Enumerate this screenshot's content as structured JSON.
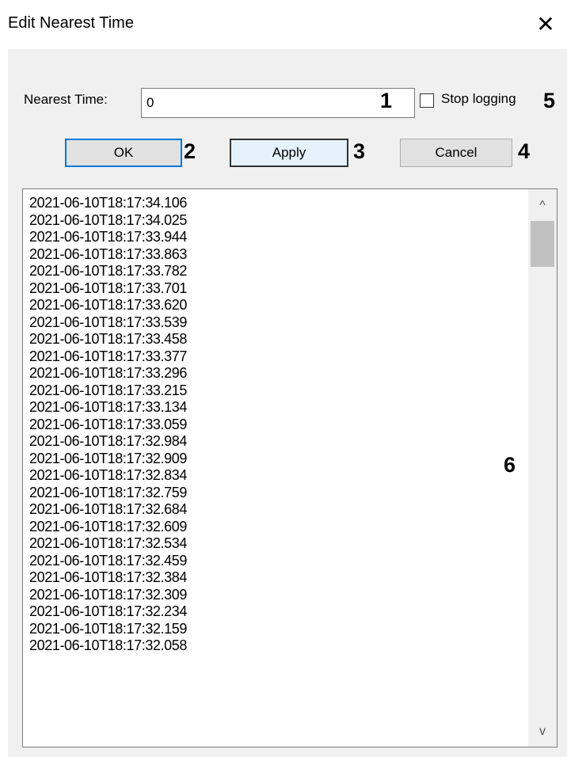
{
  "window": {
    "title": "Edit Nearest Time",
    "close_glyph": "✕"
  },
  "form": {
    "nearest_time_label": "Nearest Time:",
    "nearest_time_value": "0",
    "stop_logging_label": "Stop logging",
    "stop_logging_checked": false
  },
  "buttons": {
    "ok": "OK",
    "apply": "Apply",
    "cancel": "Cancel"
  },
  "annotations": {
    "n1": "1",
    "n2": "2",
    "n3": "3",
    "n4": "4",
    "n5": "5",
    "n6": "6"
  },
  "log": {
    "items": [
      "2021-06-10T18:17:34.106",
      "2021-06-10T18:17:34.025",
      "2021-06-10T18:17:33.944",
      "2021-06-10T18:17:33.863",
      "2021-06-10T18:17:33.782",
      "2021-06-10T18:17:33.701",
      "2021-06-10T18:17:33.620",
      "2021-06-10T18:17:33.539",
      "2021-06-10T18:17:33.458",
      "2021-06-10T18:17:33.377",
      "2021-06-10T18:17:33.296",
      "2021-06-10T18:17:33.215",
      "2021-06-10T18:17:33.134",
      "2021-06-10T18:17:33.059",
      "2021-06-10T18:17:32.984",
      "2021-06-10T18:17:32.909",
      "2021-06-10T18:17:32.834",
      "2021-06-10T18:17:32.759",
      "2021-06-10T18:17:32.684",
      "2021-06-10T18:17:32.609",
      "2021-06-10T18:17:32.534",
      "2021-06-10T18:17:32.459",
      "2021-06-10T18:17:32.384",
      "2021-06-10T18:17:32.309",
      "2021-06-10T18:17:32.234",
      "2021-06-10T18:17:32.159",
      "2021-06-10T18:17:32.058"
    ]
  },
  "scrollbar": {
    "up_glyph": "^",
    "down_glyph": "v"
  }
}
